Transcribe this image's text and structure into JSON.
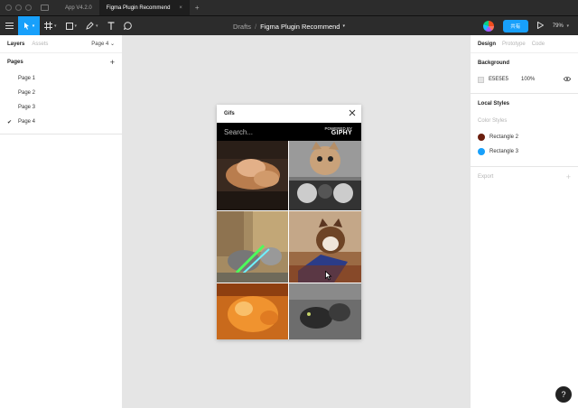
{
  "titlebar": {
    "tabs": [
      {
        "label": "App V4.2.0",
        "active": false
      },
      {
        "label": "Figma Plugin Recommend",
        "active": true
      }
    ],
    "add_tab": "+",
    "close_tab": "×"
  },
  "toolbar": {
    "breadcrumb_project": "Drafts",
    "breadcrumb_sep": "/",
    "breadcrumb_file": "Figma Plugin Recommend",
    "file_caret": "▾",
    "share_label": "共有",
    "zoom": "79%",
    "zoom_caret": "▾",
    "accent": "#18a0fb"
  },
  "left_panel": {
    "tabs": [
      "Layers",
      "Assets"
    ],
    "page_selector": "Page 4",
    "page_caret": "⌄",
    "pages_title": "Pages",
    "add": "+",
    "pages": [
      {
        "label": "Page 1",
        "current": false
      },
      {
        "label": "Page 2",
        "current": false
      },
      {
        "label": "Page 3",
        "current": false
      },
      {
        "label": "Page 4",
        "current": true
      }
    ],
    "check": "✔"
  },
  "plugin": {
    "title": "Gifs",
    "search_placeholder": "Search...",
    "brand_top": "POWERED BY",
    "brand": "GIPHY"
  },
  "right_panel": {
    "tabs": [
      "Design",
      "Prototype",
      "Code"
    ],
    "background_title": "Background",
    "background_hex": "E5E5E5",
    "background_opacity": "100%",
    "local_styles_title": "Local Styles",
    "color_styles_label": "Color Styles",
    "styles": [
      {
        "name": "Rectangle 2",
        "color": "#6b1e0e"
      },
      {
        "name": "Rectangle 3",
        "color": "#18a0fb"
      }
    ],
    "export_title": "Export",
    "export_add": "+"
  },
  "help_label": "?"
}
